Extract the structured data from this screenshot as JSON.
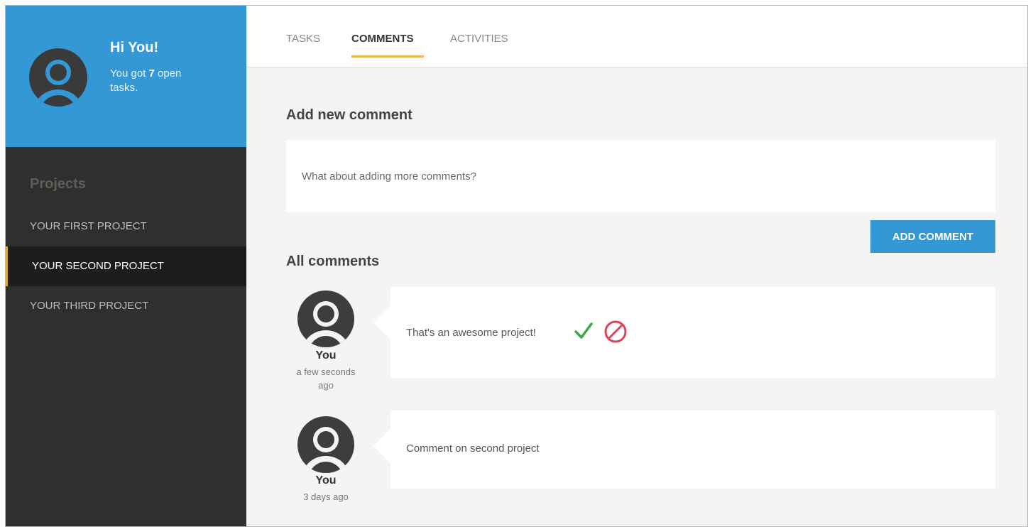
{
  "user": {
    "greeting": "Hi You!",
    "subtitle_prefix": "You got ",
    "open_count": "7",
    "subtitle_suffix": " open tasks."
  },
  "sidebar": {
    "heading": "Projects",
    "items": [
      {
        "label": "YOUR FIRST PROJECT",
        "active": false
      },
      {
        "label": "YOUR SECOND PROJECT",
        "active": true
      },
      {
        "label": "YOUR THIRD PROJECT",
        "active": false
      }
    ]
  },
  "tabs": [
    {
      "label": "TASKS",
      "active": false
    },
    {
      "label": "COMMENTS",
      "active": true
    },
    {
      "label": "ACTIVITIES",
      "active": false
    }
  ],
  "new_comment": {
    "title": "Add new comment",
    "placeholder": "What about adding more comments?",
    "button_label": "ADD COMMENT"
  },
  "all_comments": {
    "title": "All comments",
    "items": [
      {
        "author": "You",
        "time": "a few seconds ago",
        "text": "That's an awesome project!",
        "actions": [
          "check-icon",
          "ban-icon"
        ]
      },
      {
        "author": "You",
        "time": "3 days ago",
        "text": "Comment on second project"
      }
    ]
  },
  "colors": {
    "accent_blue": "#3498d4",
    "sidebar_dark": "#2f2f2d",
    "active_item": "#1d1d1b",
    "tab_underline": "#e6b94a",
    "approve_green": "#3fa64a",
    "reject_red": "#d9455b"
  }
}
